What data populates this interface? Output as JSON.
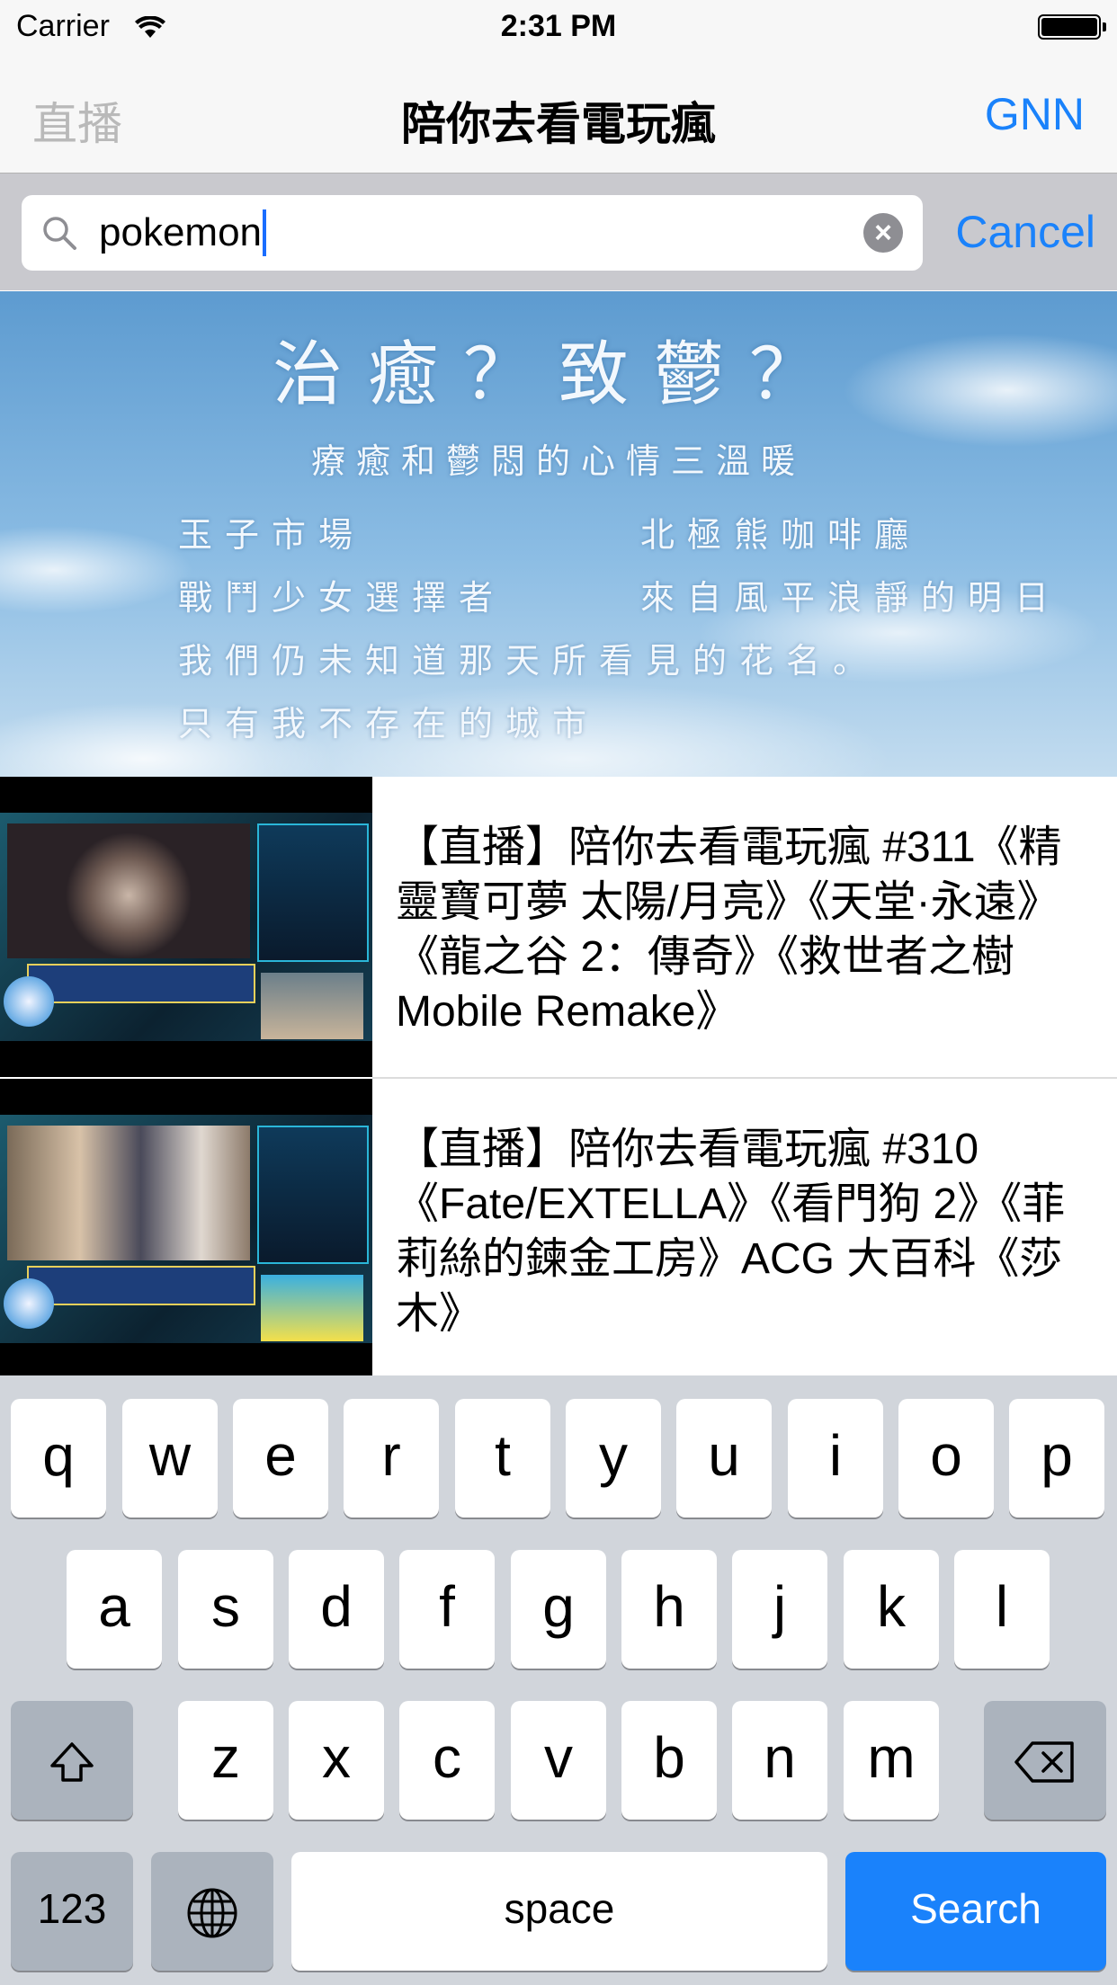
{
  "status_bar": {
    "carrier": "Carrier",
    "time": "2:31 PM"
  },
  "nav": {
    "left_label": "直播",
    "title": "陪你去看電玩瘋",
    "right_label": "GNN"
  },
  "search": {
    "query": "pokemon",
    "cancel_label": "Cancel"
  },
  "banner": {
    "title": "治癒？致鬱？",
    "subtitle": "療癒和鬱悶的心情三溫暖",
    "items": [
      "玉子市場",
      "北極熊咖啡廳",
      "戰鬥少女選擇者",
      "來自風平浪靜的明日",
      "我們仍未知道那天所看見的花名。",
      "只有我不存在的城市"
    ]
  },
  "results": [
    {
      "title": "【直播】陪你去看電玩瘋 #311《精靈寶可夢 太陽/月亮》《天堂·永遠》《龍之谷 2：傳奇》《救世者之樹 Mobile Remake》"
    },
    {
      "title": "【直播】陪你去看電玩瘋 #310《Fate/EXTELLA》《看門狗 2》《菲莉絲的鍊金工房》ACG 大百科《莎木》"
    }
  ],
  "keyboard": {
    "row1": [
      "q",
      "w",
      "e",
      "r",
      "t",
      "y",
      "u",
      "i",
      "o",
      "p"
    ],
    "row2": [
      "a",
      "s",
      "d",
      "f",
      "g",
      "h",
      "j",
      "k",
      "l"
    ],
    "row3": [
      "z",
      "x",
      "c",
      "v",
      "b",
      "n",
      "m"
    ],
    "numbers_label": "123",
    "space_label": "space",
    "search_label": "Search"
  },
  "colors": {
    "accent": "#1a82fb",
    "nav_inactive": "#b9b9b9",
    "keyboard_bg": "#d1d5db"
  }
}
